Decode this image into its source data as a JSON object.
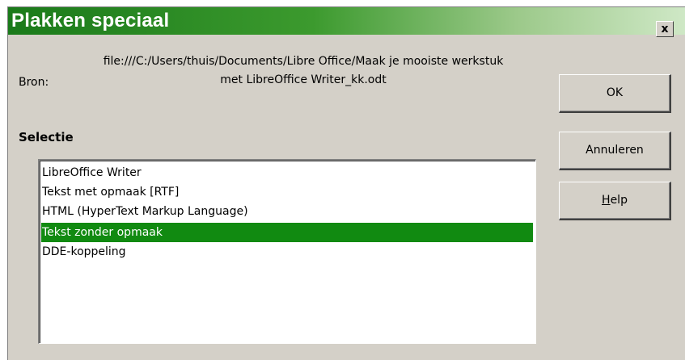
{
  "dialog": {
    "title": "Plakken speciaal",
    "close_label": "x"
  },
  "source": {
    "label": "Bron:",
    "path_line1": "file:///C:/Users/thuis/Documents/Libre Office/Maak je mooiste werkstuk",
    "path_line2": "met LibreOffice Writer_kk.odt"
  },
  "selection": {
    "heading": "Selectie",
    "items": [
      {
        "label": "LibreOffice Writer"
      },
      {
        "label": "Tekst met opmaak [RTF]"
      },
      {
        "label": "HTML (HyperText Markup Language)"
      },
      {
        "label": "Tekst zonder opmaak"
      },
      {
        "label": "DDE-koppeling"
      }
    ],
    "selected_index": 3
  },
  "buttons": {
    "ok": "OK",
    "cancel": "Annuleren",
    "help_mnemonic": "H",
    "help_rest": "elp"
  },
  "colors": {
    "title_green": "#1a7a1a",
    "selection_green": "#118a11",
    "dialog_bg": "#d4d0c8"
  }
}
